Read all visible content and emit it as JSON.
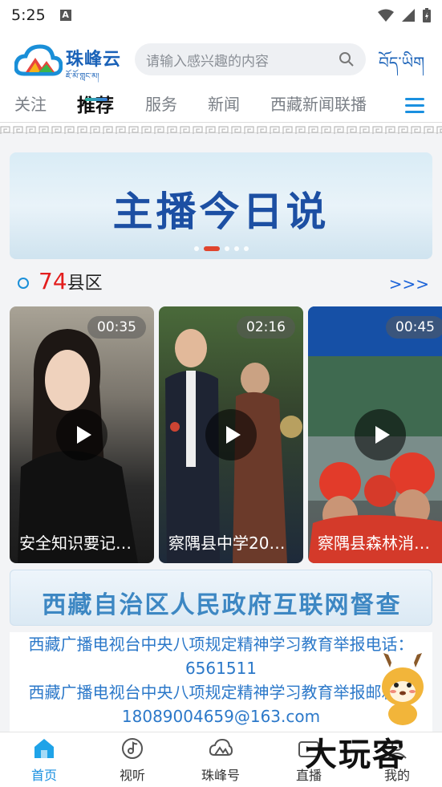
{
  "status_bar": {
    "time": "5:25",
    "notice_letter": "A"
  },
  "header": {
    "app_name": "珠峰云",
    "app_name_tibetan": "ཇོ་མོ་གླང་མ།",
    "search_placeholder": "请输入感兴趣的内容",
    "tibetan_button": "བོད་ཡིག"
  },
  "tabs": [
    {
      "label": "关注"
    },
    {
      "label": "推荐"
    },
    {
      "label": "服务"
    },
    {
      "label": "新闻"
    },
    {
      "label": "西藏新闻联播"
    }
  ],
  "banner": {
    "text": "主播今日说",
    "slide_count": 5,
    "active_slide": 2
  },
  "county_section": {
    "count": "74",
    "unit": "县区",
    "more": ">>>"
  },
  "videos": [
    {
      "duration": "00:35",
      "title": "安全知识要记…"
    },
    {
      "duration": "02:16",
      "title": "察隅县中学20…"
    },
    {
      "duration": "00:45",
      "title": "察隅县森林消…"
    }
  ],
  "supervision_banner": {
    "text": "西藏自治区人民政府互联网督查"
  },
  "report": {
    "line1": "西藏广播电视台中央八项规定精神学习教育举报电话：",
    "line2": "6561511",
    "line3": "西藏广播电视台中央八项规定精神学习教育举报邮箱：",
    "line4": "18089004659@163.com"
  },
  "bottom_nav": [
    {
      "label": "首页"
    },
    {
      "label": "视听"
    },
    {
      "label": "珠峰号"
    },
    {
      "label": "直播"
    },
    {
      "label": "我的"
    }
  ],
  "watermark": "大玩客",
  "colors": {
    "accent": "#1a62b8",
    "tab_active_bar": "#2bb39b",
    "highlight_red": "#e31d1d",
    "link_blue": "#1a62d8"
  }
}
